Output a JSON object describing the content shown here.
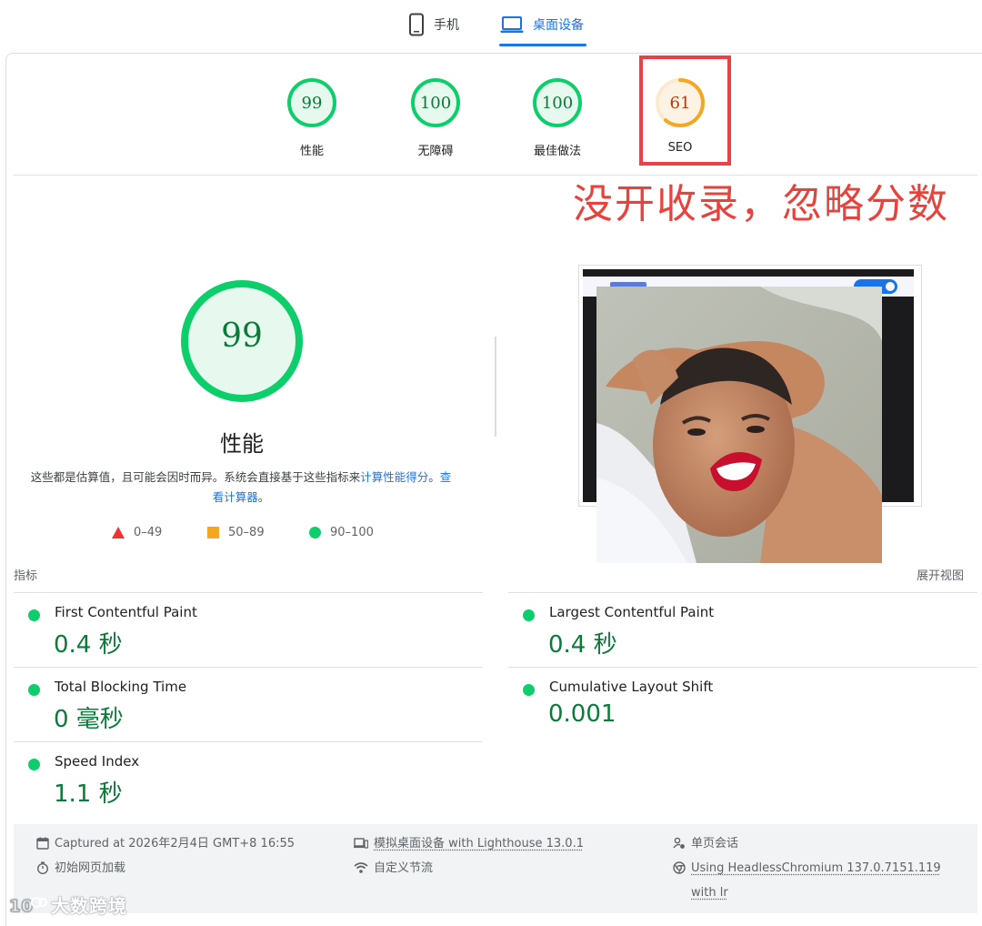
{
  "tabs": {
    "mobile": "手机",
    "desktop": "桌面设备"
  },
  "scores": [
    {
      "label": "性能",
      "value": "99",
      "score": 99,
      "color": "#0cce6b"
    },
    {
      "label": "无障碍",
      "value": "100",
      "score": 100,
      "color": "#0cce6b"
    },
    {
      "label": "最佳做法",
      "value": "100",
      "score": 100,
      "color": "#0cce6b"
    },
    {
      "label": "SEO",
      "value": "61",
      "score": 61,
      "color": "#f5a623"
    }
  ],
  "annotation": "没开收录，忽略分数",
  "performance": {
    "score": "99",
    "title": "性能",
    "desc_text": "这些都是估算值，且可能会因时而异。系统会直接基于这些指标来",
    "desc_link1": "计算性能得分",
    "desc_sep": "。",
    "desc_link2": "查看计算器",
    "desc_end": "。"
  },
  "legend": {
    "fail": "0–49",
    "average": "50–89",
    "pass": "90–100"
  },
  "metrics_section": {
    "label": "指标",
    "expand": "展开视图"
  },
  "metrics": [
    {
      "name": "First Contentful Paint",
      "value": "0.4 秒"
    },
    {
      "name": "Largest Contentful Paint",
      "value": "0.4 秒"
    },
    {
      "name": "Total Blocking Time",
      "value": "0 毫秒"
    },
    {
      "name": "Cumulative Layout Shift",
      "value": "0.001"
    },
    {
      "name": "Speed Index",
      "value": "1.1 秒"
    }
  ],
  "footer": {
    "captured": "Captured at 2026年2月4日 GMT+8 16:55",
    "initial_load": "初始网页加载",
    "emulated": "模拟桌面设备 with Lighthouse 13.0.1",
    "throttling": "自定义节流",
    "session": "单页会话",
    "browser": "Using HeadlessChromium 137.0.7151.119 with lr"
  },
  "watermark": "大数跨境",
  "colors": {
    "pass": "#0cce6b",
    "pass_text": "#0c7a3a",
    "average": "#f5a623",
    "fail": "#ef3333",
    "accent": "#1a73e8",
    "annotation": "#e8423d"
  }
}
